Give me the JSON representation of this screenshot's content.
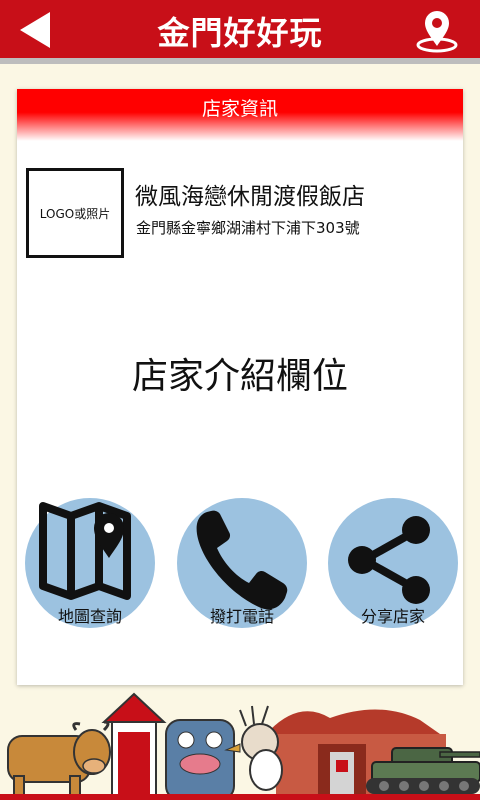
{
  "header": {
    "title": "金門好好玩",
    "back_icon": "back-arrow-icon",
    "location_icon": "map-pin-icon",
    "bar_color": "#c80f18"
  },
  "card": {
    "section_title": "店家資訊",
    "logo_placeholder": "LOGO或照片",
    "shop_name": "微風海戀休閒渡假飯店",
    "address": "金門縣金寧鄉湖浦村下浦下303號",
    "intro_placeholder": "店家介紹欄位"
  },
  "actions": [
    {
      "label": "地圖查詢",
      "icon": "map-icon"
    },
    {
      "label": "撥打電話",
      "icon": "phone-icon"
    },
    {
      "label": "分享店家",
      "icon": "share-icon"
    }
  ],
  "colors": {
    "accent": "#ff0000",
    "action_circle": "#9cc2e0",
    "background": "#fbf7e4"
  }
}
